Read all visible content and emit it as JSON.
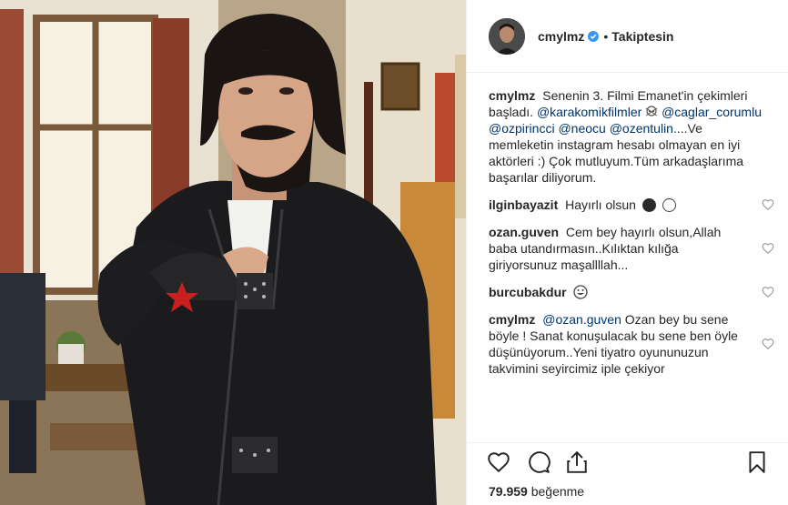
{
  "post": {
    "username": "cmylmz",
    "separator": "•",
    "follow_state": "Takiptesin",
    "caption": {
      "username": "cmylmz",
      "text_1": "Senenin 3. Filmi Emanet'in çekimleri başladı.",
      "mention_1": "@karakomikfilmler",
      "mention_2": "@caglar_corumlu",
      "mention_3": "@ozpirincci",
      "mention_4": "@neocu",
      "mention_5": "@ozentulin",
      "text_2": "....Ve memleketin instagram hesabı olmayan en iyi aktörleri :) Çok mutluyum.Tüm arkadaşlarıma başarılar diliyorum."
    },
    "comments": [
      {
        "username": "ilginbayazit",
        "text": "Hayırlı olsun"
      },
      {
        "username": "ozan.guven",
        "text": "Cem bey hayırlı olsun,Allah baba utandırmasın..Kılıktan kılığa giriyorsunuz maşallllah..."
      },
      {
        "username": "burcubakdur",
        "text": ""
      },
      {
        "username": "cmylmz",
        "mention": "@ozan.guven",
        "text": "Ozan bey bu sene böyle ! Sanat konuşulacak bu sene ben öyle düşünüyorum..Yeni tiyatro oyununuzun takvimini seyircimiz iple çekiyor"
      }
    ],
    "likes_count": "79.959",
    "likes_label": "beğenme",
    "icons": {
      "verified": "verified-badge-icon",
      "like": "heart-icon",
      "comment": "comment-bubble-icon",
      "share": "share-icon",
      "save": "bookmark-icon"
    },
    "colors": {
      "text": "#262626",
      "mention": "#003569",
      "verified": "#3897f0",
      "border": "#efefef"
    }
  }
}
